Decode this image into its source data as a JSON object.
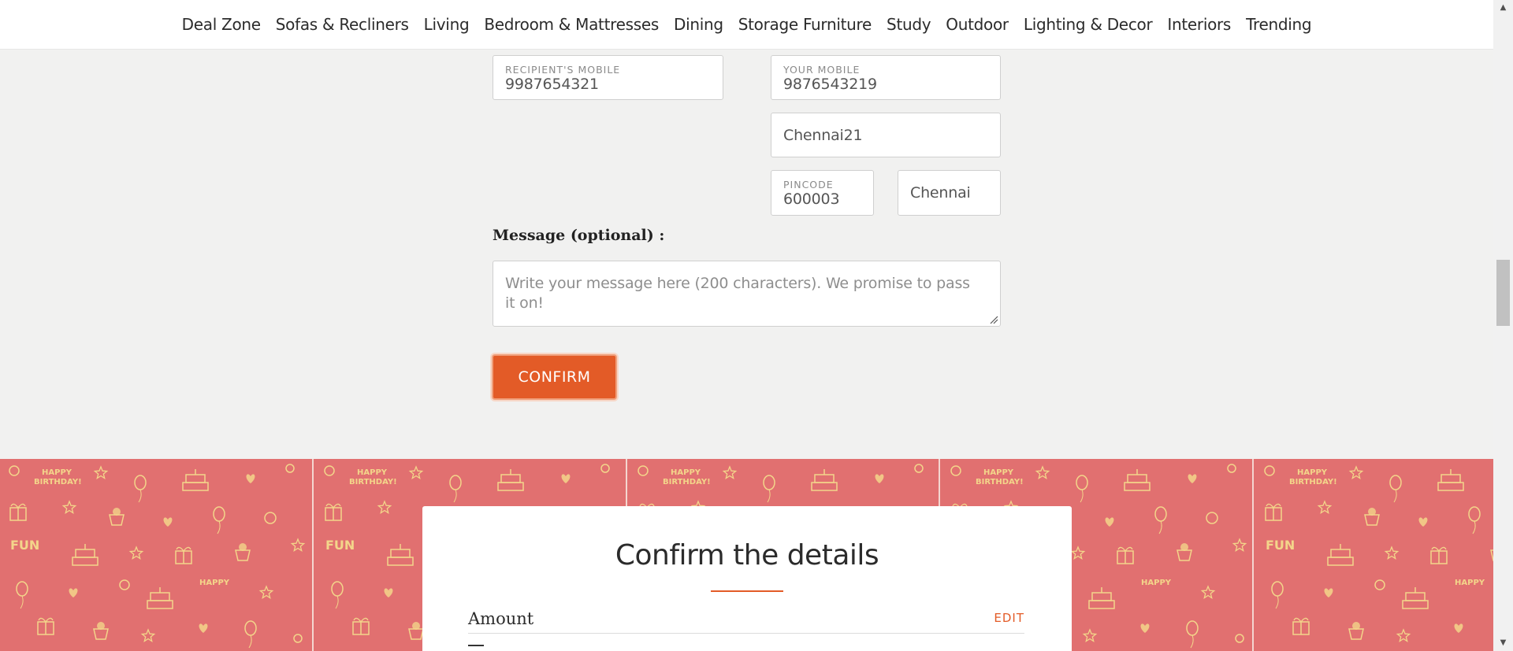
{
  "nav": {
    "items": [
      "Deal Zone",
      "Sofas & Recliners",
      "Living",
      "Bedroom & Mattresses",
      "Dining",
      "Storage Furniture",
      "Study",
      "Outdoor",
      "Lighting & Decor",
      "Interiors",
      "Trending"
    ]
  },
  "form": {
    "recipient_mobile": {
      "label": "RECIPIENT'S MOBILE",
      "value": "9987654321"
    },
    "your_mobile": {
      "label": "YOUR MOBILE",
      "value": "9876543219"
    },
    "address": {
      "value": "Chennai21"
    },
    "pincode": {
      "label": "PINCODE",
      "value": "600003"
    },
    "city": {
      "value": "Chennai"
    },
    "message_label": "Message (optional) :",
    "message_placeholder": "Write your message here (200 characters). We promise to pass it on!",
    "confirm_label": "CONFIRM"
  },
  "banner": {
    "pattern_text": "HAPPY BIRTHDAY!",
    "fun_text": "FUN",
    "bg_color": "#e17070",
    "motif_color": "#f3d58a"
  },
  "confirm_card": {
    "title": "Confirm the details",
    "amount_label": "Amount",
    "edit_label": "EDIT"
  },
  "colors": {
    "accent": "#e35b27",
    "page_bg": "#f1f1f0"
  }
}
